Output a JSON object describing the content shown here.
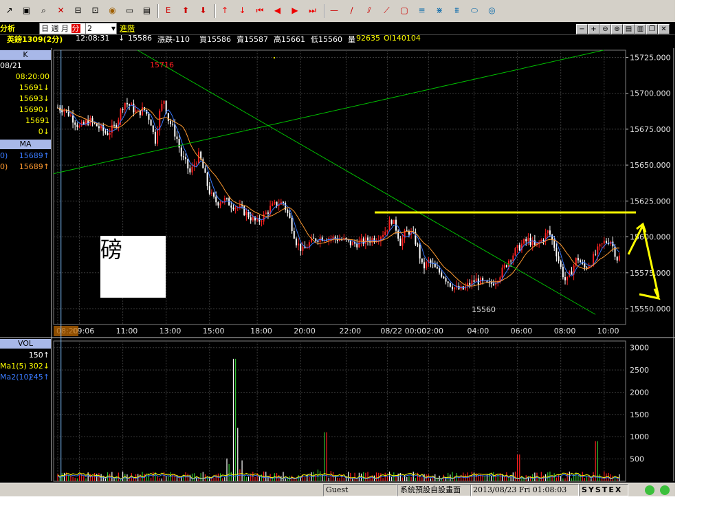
{
  "toolbar": {
    "icons": [
      "arrow-icon",
      "monitor-icon",
      "zoom-icon",
      "cross-icon",
      "scale-icon",
      "box-icon",
      "coin-icon",
      "card-icon",
      "window-icon",
      "letter-e-icon",
      "up-box-icon",
      "down-box-icon",
      "arrow-up-icon",
      "arrow-down-icon",
      "first-icon",
      "left-icon",
      "right-icon",
      "last-icon",
      "hline-icon",
      "trendline-icon",
      "channel-icon",
      "ray-icon",
      "rect-icon",
      "fib-icon",
      "gann-icon",
      "cycle-icon",
      "ellipse-icon",
      "circle-icon"
    ]
  },
  "infobar": {
    "title": "分析",
    "period_buttons": [
      "日",
      "週",
      "月",
      "分"
    ],
    "period_selected": "分",
    "period_value": "2",
    "advanced": "進階",
    "symbol": "英鎊1309(2分)",
    "time": "12:08:31",
    "arrow": "↓",
    "last": "15586",
    "change": "漲跌-110",
    "bid": "買15586",
    "ask": "賣15587",
    "high": "高15661",
    "low": "低15560",
    "volume_label": "量",
    "volume_value": "92635",
    "oi": "OI140104"
  },
  "left_panel": {
    "k_header": "K",
    "date": "08/21",
    "time": "08:20:00",
    "values": [
      "15691↓",
      "15693↓",
      "15690↓",
      "15691",
      "0↓"
    ],
    "ma_header": "MA",
    "ma_rows": [
      {
        "label": "0)",
        "value": "15689↑"
      },
      {
        "label": "0)",
        "value": "15689↑"
      }
    ],
    "vol_header": "VOL",
    "vol_rows": [
      {
        "label": "",
        "value": "150↑"
      },
      {
        "label": "Ma1(5)",
        "value": "302↓"
      },
      {
        "label": "Ma2(10)",
        "value": "245↑"
      }
    ]
  },
  "annotation_box_text": "磅",
  "colors": {
    "up": "#ff2020",
    "down": "#ffffff",
    "ma_fast": "#3a7bff",
    "ma_slow": "#ff9a30",
    "trendline": "#00c000",
    "resistance": "#ffff00",
    "axis": "#c0c0c0"
  },
  "statusbar": {
    "user": "Guest",
    "layout": "系統預設自設畫面",
    "datetime": "2013/08/23 Fri 01:08:03",
    "brand": "SYSTEX"
  },
  "chart_data": {
    "type": "candlestick",
    "price_axis": {
      "ticks": [
        "15725.000",
        "15700.000",
        "15675.000",
        "15650.000",
        "15625.000",
        "15600.000",
        "15575.000",
        "15550.000"
      ],
      "ylim": [
        15539,
        15730
      ]
    },
    "volume_axis": {
      "ticks": [
        "3000",
        "2500",
        "2000",
        "1500",
        "1000",
        "500"
      ],
      "ylim": [
        0,
        3150
      ]
    },
    "time_ticks": [
      "08:20",
      "09:06",
      "11:00",
      "13:00",
      "15:00",
      "18:00",
      "20:00",
      "22:00",
      "08/22 00:00",
      "02:00",
      "04:00",
      "06:00",
      "08:00",
      "10:00"
    ],
    "price_path": [
      [
        0,
        15690
      ],
      [
        3,
        15689
      ],
      [
        6,
        15684
      ],
      [
        10,
        15676
      ],
      [
        14,
        15681
      ],
      [
        18,
        15677
      ],
      [
        22,
        15672
      ],
      [
        26,
        15677
      ],
      [
        30,
        15694
      ],
      [
        33,
        15691
      ],
      [
        36,
        15686
      ],
      [
        39,
        15689
      ],
      [
        42,
        15681
      ],
      [
        44,
        15666
      ],
      [
        46,
        15686
      ],
      [
        48,
        15696
      ],
      [
        50,
        15682
      ],
      [
        52,
        15676
      ],
      [
        54,
        15668
      ],
      [
        56,
        15656
      ],
      [
        58,
        15651
      ],
      [
        60,
        15644
      ],
      [
        62,
        15652
      ],
      [
        64,
        15657
      ],
      [
        66,
        15646
      ],
      [
        68,
        15634
      ],
      [
        70,
        15627
      ],
      [
        72,
        15624
      ],
      [
        75,
        15626
      ],
      [
        78,
        15623
      ],
      [
        81,
        15621
      ],
      [
        84,
        15618
      ],
      [
        87,
        15614
      ],
      [
        90,
        15610
      ],
      [
        93,
        15614
      ],
      [
        96,
        15620
      ],
      [
        99,
        15623
      ],
      [
        102,
        15624
      ],
      [
        105,
        15612
      ],
      [
        108,
        15596
      ],
      [
        111,
        15590
      ],
      [
        114,
        15596
      ],
      [
        117,
        15599
      ],
      [
        121,
        15600
      ],
      [
        125,
        15599
      ],
      [
        129,
        15598
      ],
      [
        133,
        15595
      ],
      [
        137,
        15596
      ],
      [
        141,
        15598
      ],
      [
        145,
        15600
      ],
      [
        148,
        15604
      ],
      [
        151,
        15612
      ],
      [
        153,
        15606
      ],
      [
        155,
        15596
      ],
      [
        157,
        15602
      ],
      [
        159,
        15604
      ],
      [
        161,
        15600
      ],
      [
        163,
        15592
      ],
      [
        165,
        15578
      ],
      [
        168,
        15583
      ],
      [
        171,
        15577
      ],
      [
        174,
        15574
      ],
      [
        177,
        15568
      ],
      [
        180,
        15564
      ],
      [
        183,
        15563
      ],
      [
        186,
        15567
      ],
      [
        189,
        15570
      ],
      [
        192,
        15568
      ],
      [
        195,
        15566
      ],
      [
        198,
        15570
      ],
      [
        201,
        15576
      ],
      [
        204,
        15584
      ],
      [
        207,
        15590
      ],
      [
        210,
        15595
      ],
      [
        213,
        15598
      ],
      [
        216,
        15593
      ],
      [
        219,
        15598
      ],
      [
        222,
        15604
      ],
      [
        225,
        15592
      ],
      [
        228,
        15576
      ],
      [
        230,
        15568
      ],
      [
        232,
        15575
      ],
      [
        235,
        15586
      ],
      [
        238,
        15578
      ],
      [
        241,
        15582
      ],
      [
        244,
        15590
      ],
      [
        247,
        15596
      ],
      [
        250,
        15598
      ],
      [
        253,
        15585
      ],
      [
        255,
        15587
      ]
    ],
    "annotations": {
      "high_label": "15716",
      "low_label": "15560"
    },
    "volume_spikes": [
      [
        80,
        2750
      ],
      [
        81,
        1200
      ],
      [
        121,
        1100
      ],
      [
        208,
        600
      ],
      [
        244,
        900
      ],
      [
        258,
        1300
      ]
    ]
  }
}
